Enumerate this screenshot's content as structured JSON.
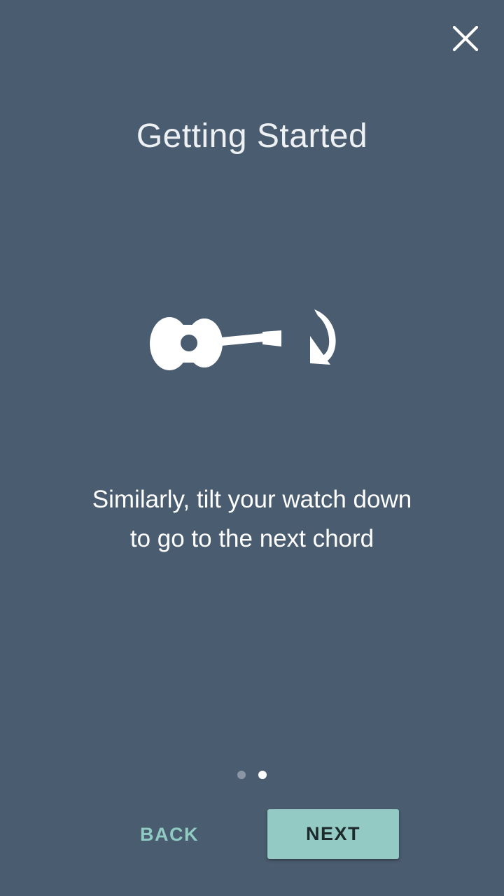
{
  "header": {
    "close_icon": "close-icon",
    "title": "Getting Started"
  },
  "illustration": {
    "guitar_icon": "guitar-icon",
    "rotate_icon": "rotate-clockwise-arrow-icon"
  },
  "message": {
    "text": "Similarly, tilt your watch down to go to the next chord"
  },
  "pager": {
    "total_pages": 2,
    "current_page": 2
  },
  "footer": {
    "back_label": "BACK",
    "next_label": "NEXT"
  },
  "colors": {
    "background": "#4a5c6f",
    "accent": "#93cbc4",
    "back_text": "#8fcac3",
    "dot_inactive": "#8a96a3",
    "dot_active": "#ffffff"
  }
}
